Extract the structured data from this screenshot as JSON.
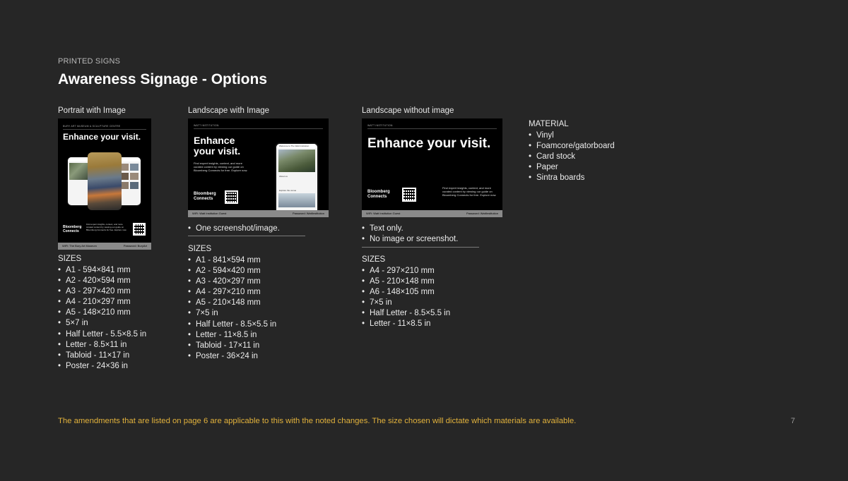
{
  "header": {
    "eyebrow": "PRINTED SIGNS",
    "title": "Awareness Signage - Options"
  },
  "portrait": {
    "title": "Portrait with Image",
    "card": {
      "top_label": "BURY ART MUSEUM & SCULPTURE CENTRE",
      "headline": "Enhance your visit.",
      "logo_line1": "Bloomberg",
      "logo_line2": "Connects",
      "blurb": "Find expert insights, context, and more curated content by viewing our guide on Bloomberg Connects for free. Explore now.",
      "bar_left": "WiFi: The Bury Art Museum",
      "bar_right": "Password: BuryArt"
    },
    "sizes_heading": "SIZES",
    "sizes": [
      "A1 - 594×841 mm",
      "A2 - 420×594 mm",
      "A3 - 297×420 mm",
      "A4 - 210×297 mm",
      "A5 - 148×210 mm",
      "5×7 in",
      "Half Letter - 5.5×8.5 in",
      "Letter - 8.5×11 in",
      "Tabloid - 11×17 in",
      "Poster - 24×36 in"
    ]
  },
  "landscape_image": {
    "title": "Landscape with Image",
    "card": {
      "top_label": "WATT INSTITUTION",
      "headline_line1": "Enhance",
      "headline_line2": "your visit.",
      "blurb": "Find expert insights, context, and more curated content by viewing our guide on Bloomberg Connects for free. Explore now.",
      "logo_line1": "Bloomberg",
      "logo_line2": "Connects",
      "phone_title": "Welcome to The Watt Institution",
      "phone_section1": "About us",
      "phone_section2": "Explore the venue",
      "bar_left": "WiFi: Watt Institution Guest",
      "bar_right": "Password: WattInstitution"
    },
    "notes": [
      "One screenshot/image."
    ],
    "sizes_heading": "SIZES",
    "sizes": [
      "A1 - 841×594 mm",
      "A2 - 594×420 mm",
      "A3 - 420×297 mm",
      "A4 - 297×210 mm",
      "A5 - 210×148 mm",
      "7×5 in",
      "Half Letter - 8.5×5.5 in",
      "Letter - 11×8.5 in",
      "Tabloid - 17×11 in",
      "Poster - 36×24 in"
    ]
  },
  "landscape_no_image": {
    "title": "Landscape without image",
    "card": {
      "top_label": "WATT INSTITUTION",
      "headline": "Enhance your visit.",
      "logo_line1": "Bloomberg",
      "logo_line2": "Connects",
      "blurb": "Find expert insights, context, and more curated content by viewing our guide on Bloomberg Connects for free. Explore now.",
      "bar_left": "WiFi: Watt Institution Guest",
      "bar_right": "Password: WattInstitution"
    },
    "notes": [
      "Text only.",
      "No image or screenshot."
    ],
    "sizes_heading": "SIZES",
    "sizes": [
      "A4 - 297×210 mm",
      "A5 - 210×148 mm",
      "A6 - 148×105 mm",
      "7×5 in",
      "Half Letter - 8.5×5.5 in",
      "Letter - 11×8.5 in"
    ]
  },
  "material": {
    "heading": "MATERIAL",
    "items": [
      "Vinyl",
      "Foamcore/gatorboard",
      "Card stock",
      "Paper",
      "Sintra boards"
    ]
  },
  "footer": {
    "note": "The amendments that are listed on page 6 are applicable to this with the noted changes. The size chosen will dictate which materials are available.",
    "page_number": "7"
  }
}
